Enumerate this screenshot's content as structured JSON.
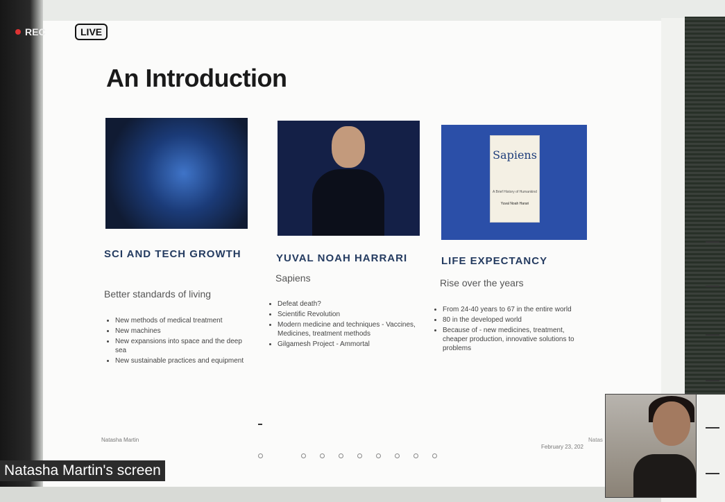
{
  "recording": {
    "rec_label": "REC",
    "live_label": "LIVE"
  },
  "slide": {
    "title": "An Introduction",
    "columns": [
      {
        "heading": "SCI AND TECH GROWTH",
        "subtitle": "Better standards of living",
        "bullets": [
          "New methods of medical treatment",
          "New machines",
          "New expansions into space and the deep sea",
          "New sustainable practices and equipment"
        ]
      },
      {
        "heading": "YUVAL NOAH HARRARI",
        "subtitle": "Sapiens",
        "bullets": [
          "Defeat death?",
          "Scientific Revolution",
          "Modern medicine and techniques - Vaccines, Medicines, treatment methods",
          "Gilgamesh Project - Ammortal"
        ]
      },
      {
        "heading": "LIFE EXPECTANCY",
        "subtitle": "Rise over the years",
        "bullets": [
          "From 24-40 years to 67 in the entire world",
          "80 in the developed world",
          "Because of - new medicines, treatment, cheaper production, innovative solutions to problems"
        ]
      }
    ],
    "book": {
      "title": "Sapiens",
      "subtitle": "A Brief History of Humankind",
      "author": "Yuval Noah Harari"
    },
    "footer_left": "Natasha Martin",
    "footer_right_top": "Natas",
    "footer_right": "February 23, 202"
  },
  "screen_label": "Natasha Martin's screen",
  "icons": [
    "recording-dot-icon",
    "slide-nav-dot-icon"
  ],
  "colors": {
    "heading": "#243b60",
    "rec_dot": "#d33333"
  }
}
